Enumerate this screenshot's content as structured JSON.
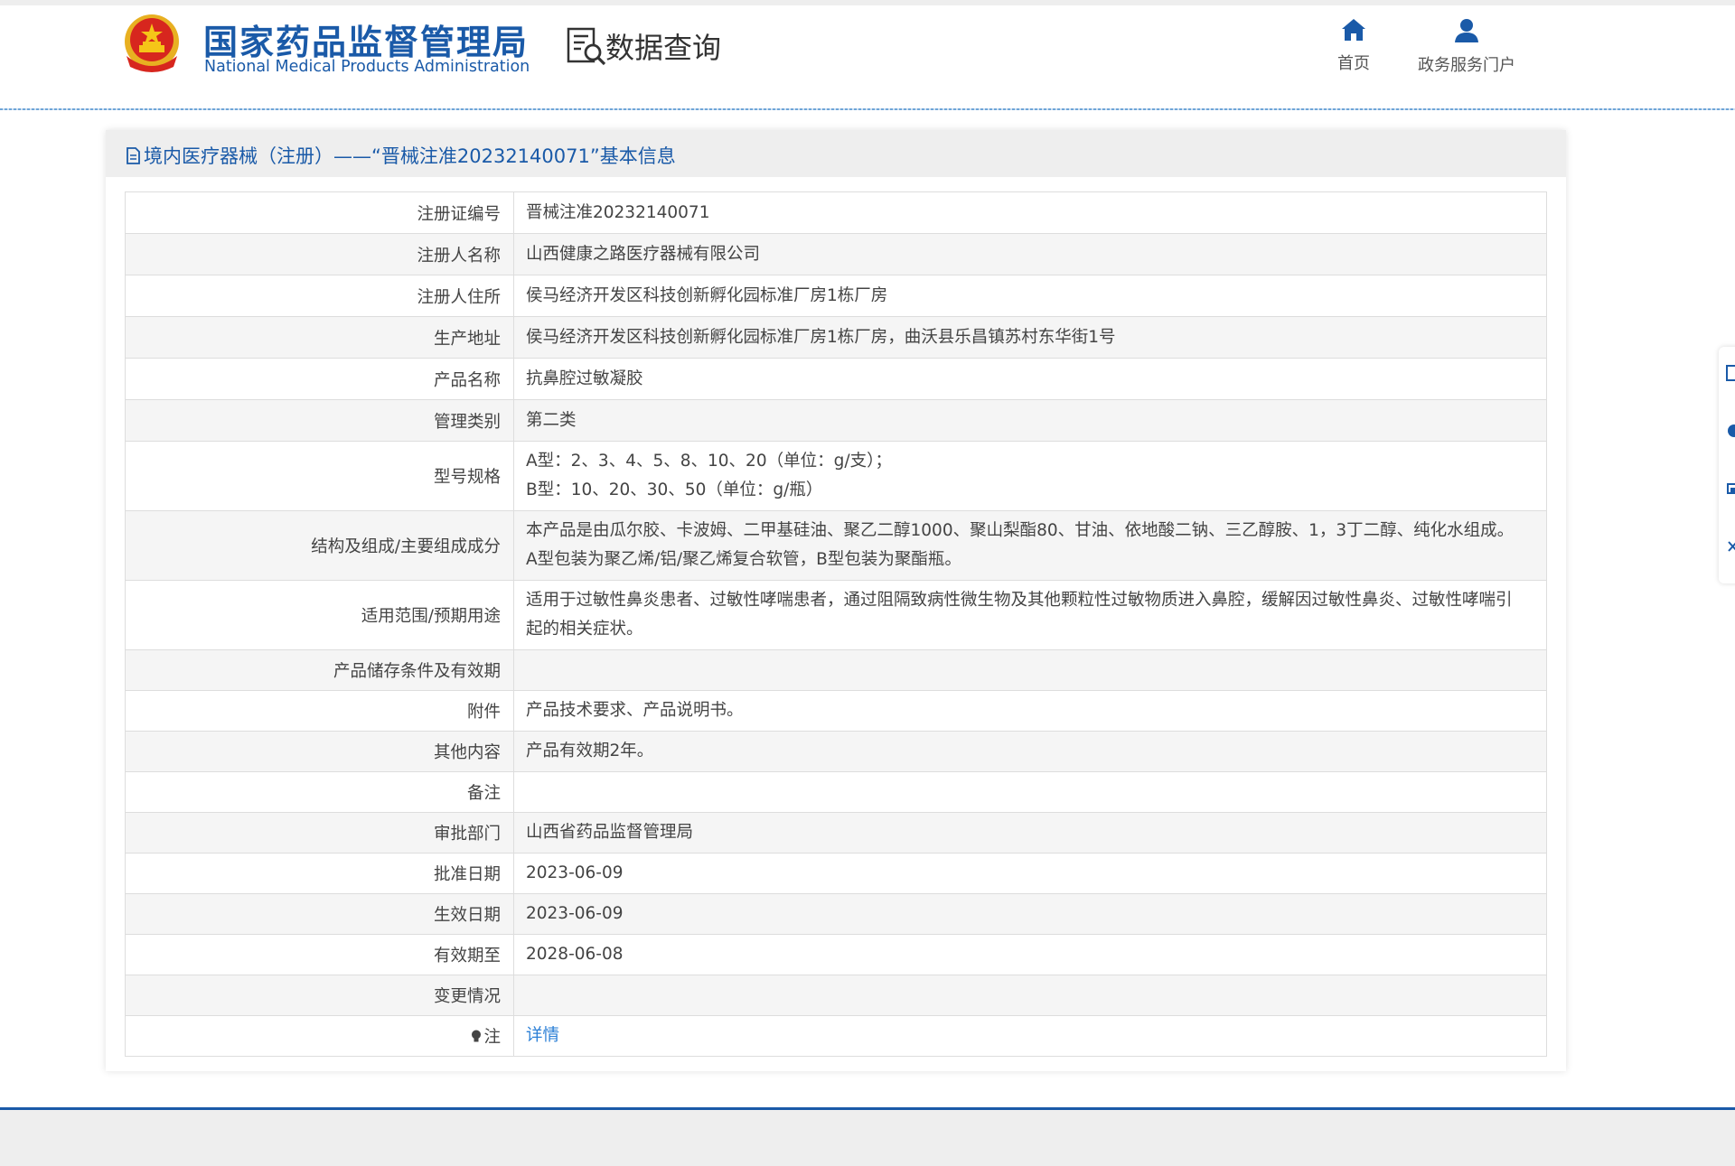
{
  "header": {
    "logo_cn": "国家药品监督管理局",
    "logo_en": "National Medical Products Administration",
    "section_title": "数据查询",
    "nav": [
      {
        "label": "首页",
        "icon": "home-icon"
      },
      {
        "label": "政务服务门户",
        "icon": "user-icon"
      }
    ]
  },
  "panel": {
    "title": "境内医疗器械（注册）——“晋械注准20232140071”基本信息"
  },
  "rows": [
    {
      "key": "注册证编号",
      "value": "晋械注准20232140071"
    },
    {
      "key": "注册人名称",
      "value": "山西健康之路医疗器械有限公司"
    },
    {
      "key": "注册人住所",
      "value": "侯马经济开发区科技创新孵化园标准厂房1栋厂房"
    },
    {
      "key": "生产地址",
      "value": "侯马经济开发区科技创新孵化园标准厂房1栋厂房，曲沃县乐昌镇苏村东华街1号"
    },
    {
      "key": "产品名称",
      "value": "抗鼻腔过敏凝胶"
    },
    {
      "key": "管理类别",
      "value": "第二类"
    },
    {
      "key": "型号规格",
      "value_lines": [
        "A型：2、3、4、5、8、10、20（单位：g/支）；",
        "B型：10、20、30、50（单位：g/瓶）"
      ]
    },
    {
      "key": "结构及组成/主要组成成分",
      "value_lines": [
        "本产品是由瓜尔胶、卡波姆、二甲基硅油、聚乙二醇1000、聚山梨酯80、甘油、依地酸二钠、三乙醇胺、1，3丁二醇、纯化水组成。",
        "A型包装为聚乙烯/铝/聚乙烯复合软管，B型包装为聚酯瓶。"
      ]
    },
    {
      "key": "适用范围/预期用途",
      "value_lines": [
        "适用于过敏性鼻炎患者、过敏性哮喘患者，通过阻隔致病性微生物及其他颗粒性过敏物质进入鼻腔，缓解因过敏性鼻炎、过敏性哮喘引",
        "起的相关症状。"
      ]
    },
    {
      "key": "产品储存条件及有效期",
      "value": ""
    },
    {
      "key": "附件",
      "value": "产品技术要求、产品说明书。"
    },
    {
      "key": "其他内容",
      "value": "产品有效期2年。"
    },
    {
      "key": "备注",
      "value": ""
    },
    {
      "key": "审批部门",
      "value": "山西省药品监督管理局"
    },
    {
      "key": "批准日期",
      "value": "2023-06-09"
    },
    {
      "key": "生效日期",
      "value": "2023-06-09"
    },
    {
      "key": "有效期至",
      "value": "2028-06-08"
    },
    {
      "key": "变更情况",
      "value": ""
    },
    {
      "key": "注",
      "value": "详情"
    }
  ],
  "colors": {
    "brand_blue": "#1a5aa8",
    "link_blue": "#2b7fd6",
    "row_stripe": "#f5f5f5",
    "border": "#dddddd"
  }
}
